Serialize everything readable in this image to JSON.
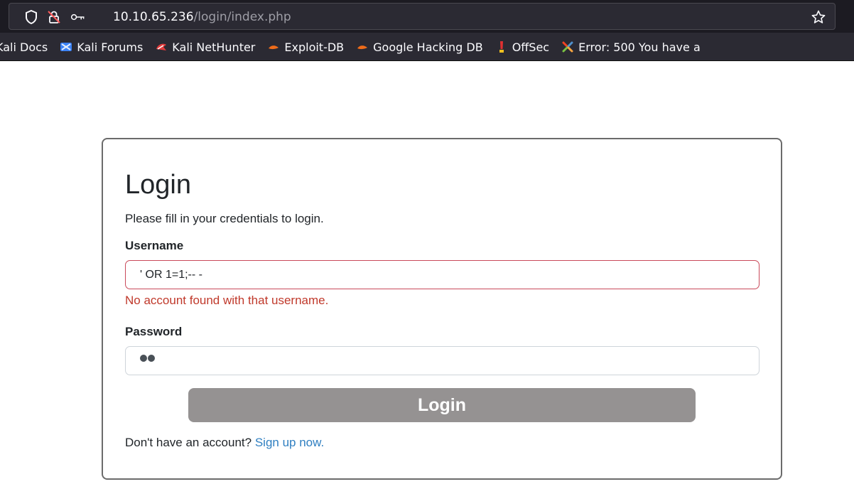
{
  "browser": {
    "url_host": "10.10.65.236",
    "url_path": "/login/index.php",
    "icons": [
      "shield-icon",
      "lock-slash-icon",
      "key-icon",
      "bookmark-star-icon"
    ],
    "bookmarks": [
      {
        "label": "Kali Docs",
        "icon": "kali-docs-icon"
      },
      {
        "label": "Kali Forums",
        "icon": "kali-forums-icon"
      },
      {
        "label": "Kali NetHunter",
        "icon": "kali-nethunter-icon"
      },
      {
        "label": "Exploit-DB",
        "icon": "exploit-db-icon"
      },
      {
        "label": "Google Hacking DB",
        "icon": "ghdb-icon"
      },
      {
        "label": "OffSec",
        "icon": "offsec-icon"
      },
      {
        "label": "Error: 500 You have a",
        "icon": "joomla-icon"
      }
    ]
  },
  "login": {
    "title": "Login",
    "subtitle": "Please fill in your credentials to login.",
    "username_label": "Username",
    "username_value": "' OR 1=1;-- -",
    "username_error": "No account found with that username.",
    "password_label": "Password",
    "password_value": "••",
    "submit_label": "Login",
    "footer_text": "Don't have an account?",
    "signup_link": "Sign up now."
  },
  "colors": {
    "chrome_bg": "#1c1b22",
    "urlbar_bg": "#2b2a33",
    "error": "#c0392b",
    "link": "#2f7fc1",
    "button": "#959292"
  }
}
